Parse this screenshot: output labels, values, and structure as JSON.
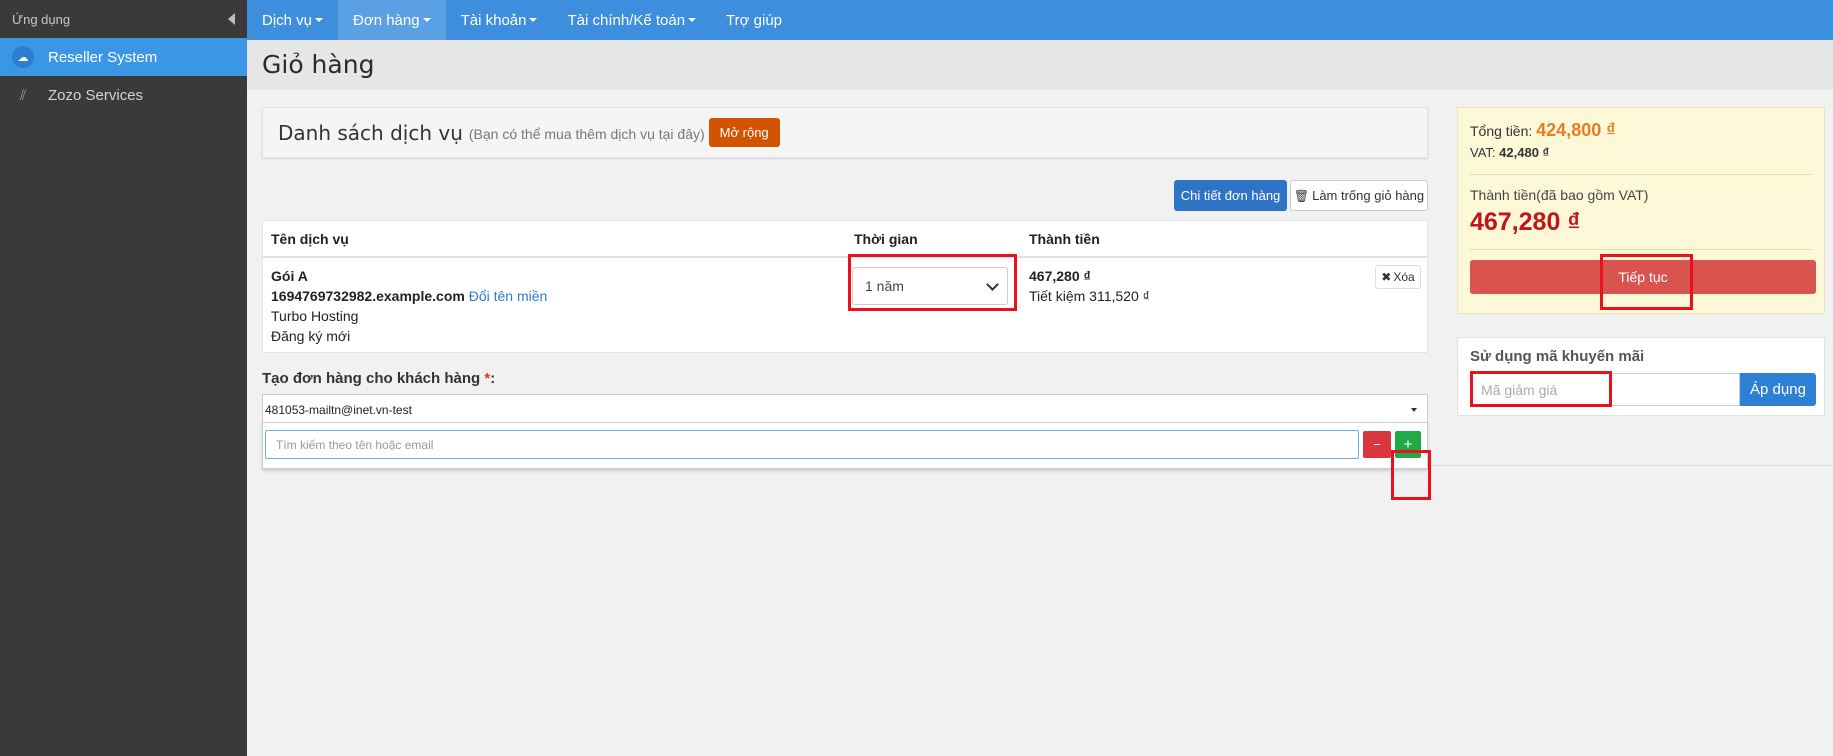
{
  "sidebar": {
    "header": "Ứng dụng",
    "items": [
      {
        "label": "Reseller System"
      },
      {
        "label": "Zozo Services"
      }
    ]
  },
  "nav": [
    {
      "label": "Dịch vụ"
    },
    {
      "label": "Đơn hàng"
    },
    {
      "label": "Tài khoản"
    },
    {
      "label": "Tài chính/Kế toán"
    },
    {
      "label": "Trợ giúp"
    }
  ],
  "page": {
    "title": "Giỏ hàng"
  },
  "services": {
    "title": "Danh sách dịch vụ",
    "subtitle": "(Bạn có thể mua thêm dịch vụ tại đây)",
    "expand_button": "Mở rộng",
    "detail_button": "Chi tiết đơn hàng",
    "empty_button": "Làm trống giỏ hàng"
  },
  "table": {
    "headers": [
      "Tên dịch vụ",
      "Thời gian",
      "Thành tiền"
    ],
    "row": {
      "package": "Gói A",
      "domain": "1694769732982.example.com",
      "rename_link": "Đổi tên miền",
      "product": "Turbo Hosting",
      "type": "Đăng ký mới",
      "period": "1 năm",
      "price": "467,280 ₫",
      "savings": "Tiết kiệm 311,520 ₫",
      "remove": "Xóa"
    }
  },
  "customer": {
    "label": "Tạo đơn hàng cho khách hàng",
    "required": "*",
    "selected": "481053-mailtn@inet.vn-test",
    "search_placeholder": "Tìm kiếm theo tên hoặc email",
    "minus": "−",
    "plus": "+"
  },
  "summary": {
    "total_label": "Tổng tiền:",
    "total_value": "424,800 ₫",
    "vat_label": "VAT:",
    "vat_value": "42,480 ₫",
    "final_label": "Thành tiền(đã bao gồm VAT)",
    "final_value": "467,280 ₫",
    "continue_button": "Tiếp tục"
  },
  "promo": {
    "title": "Sử dụng mã khuyến mãi",
    "placeholder": "Mã giảm giá",
    "apply_button": "Áp dụng"
  },
  "colors": {
    "nav": "#3d8fdd",
    "sidebar": "#3a3a3a",
    "accent_orange": "#d35400",
    "danger": "#d9534f",
    "highlight": "#e8121d"
  }
}
